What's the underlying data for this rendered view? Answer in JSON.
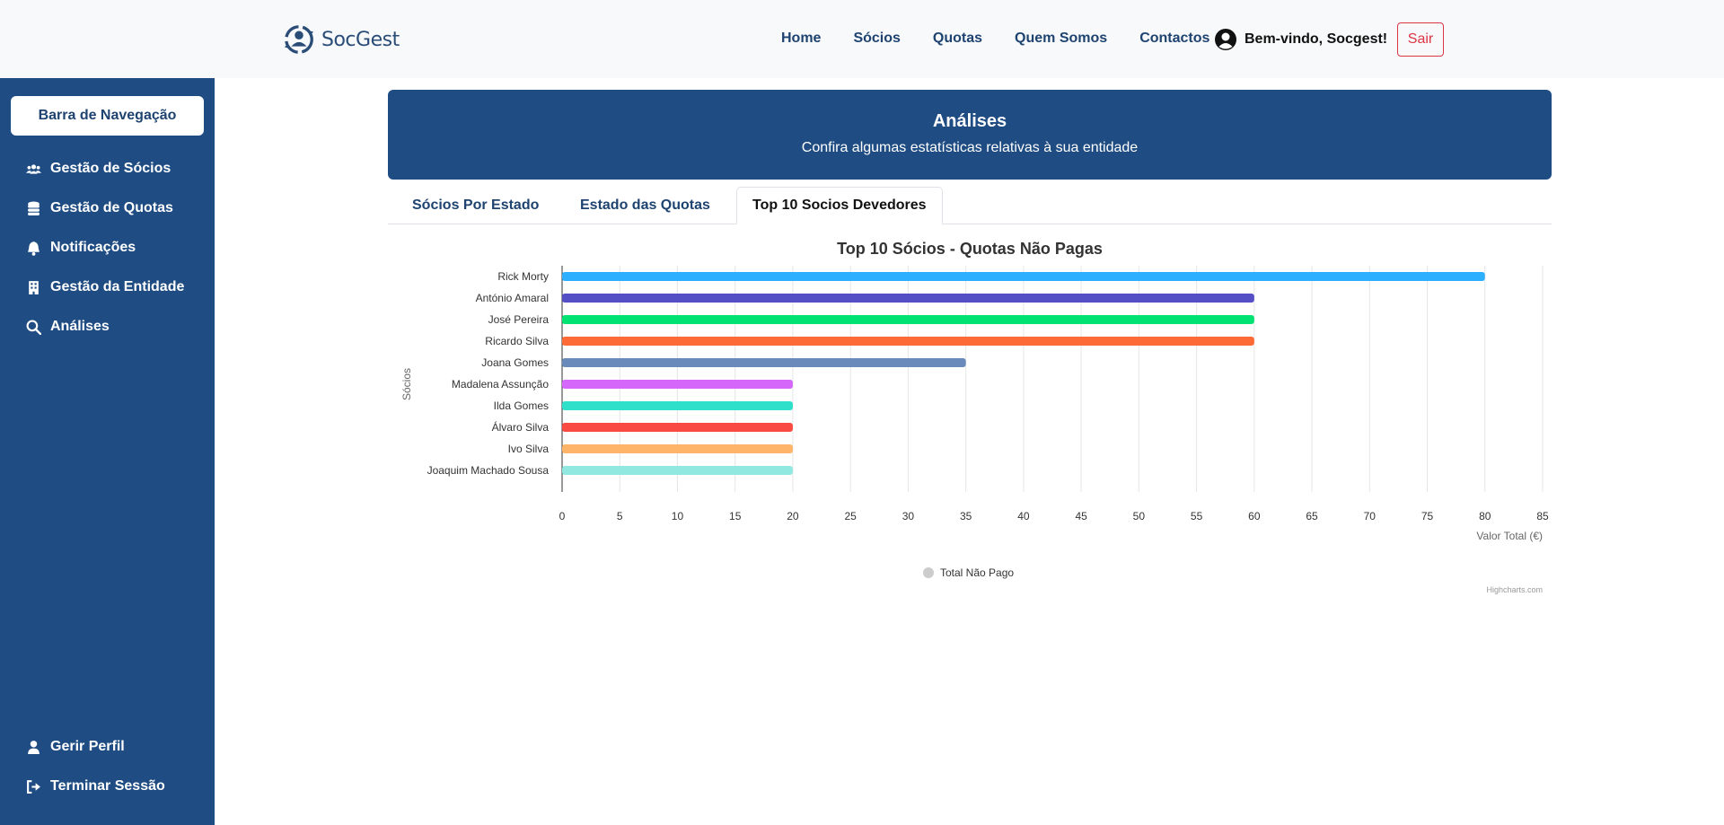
{
  "header": {
    "logo_text": "SocGest",
    "nav": [
      "Home",
      "Sócios",
      "Quotas",
      "Quem Somos",
      "Contactos"
    ],
    "welcome": "Bem-vindo, Socgest!",
    "logout_label": "Sair"
  },
  "sidebar": {
    "title": "Barra de Navegação",
    "items": [
      {
        "label": "Gestão de Sócios",
        "icon": "users-icon"
      },
      {
        "label": "Gestão de Quotas",
        "icon": "coins-icon"
      },
      {
        "label": "Notificações",
        "icon": "bell-icon"
      },
      {
        "label": "Gestão da Entidade",
        "icon": "building-icon"
      },
      {
        "label": "Análises",
        "icon": "search-icon"
      }
    ],
    "bottom_items": [
      {
        "label": "Gerir Perfil",
        "icon": "user-icon"
      },
      {
        "label": "Terminar Sessão",
        "icon": "logout-icon"
      }
    ]
  },
  "banner": {
    "title": "Análises",
    "subtitle": "Confira algumas estatísticas relativas à sua entidade"
  },
  "tabs": [
    "Sócios Por Estado",
    "Estado das Quotas",
    "Top 10 Socios Devedores"
  ],
  "chart_data": {
    "type": "bar",
    "orientation": "horizontal",
    "title": "Top 10 Sócios - Quotas Não Pagas",
    "xlabel": "Sócios",
    "ylabel": "Valor Total (€)",
    "categories": [
      "Rick Morty",
      "António Amaral",
      "José Pereira",
      "Ricardo Silva",
      "Joana Gomes",
      "Madalena Assunção",
      "Ilda Gomes",
      "Álvaro Silva",
      "Ivo Silva",
      "Joaquim Machado Sousa"
    ],
    "series": [
      {
        "name": "Total Não Pago",
        "values": [
          80,
          60,
          60,
          60,
          35,
          20,
          20,
          20,
          20,
          20
        ],
        "colors": [
          "#2caffe",
          "#544fc5",
          "#00e272",
          "#fe6a35",
          "#6b8abc",
          "#d568fb",
          "#2ee0ca",
          "#fa4b42",
          "#feb56a",
          "#91e8e1"
        ]
      }
    ],
    "ylim": [
      0,
      85
    ],
    "ticks": [
      "0",
      "5",
      "10",
      "15",
      "20",
      "25",
      "30",
      "35",
      "40",
      "45",
      "50",
      "55",
      "60",
      "65",
      "70",
      "75",
      "80",
      "85"
    ],
    "grid": true,
    "legend_position": "bottom-center",
    "credits": "Highcharts.com"
  }
}
